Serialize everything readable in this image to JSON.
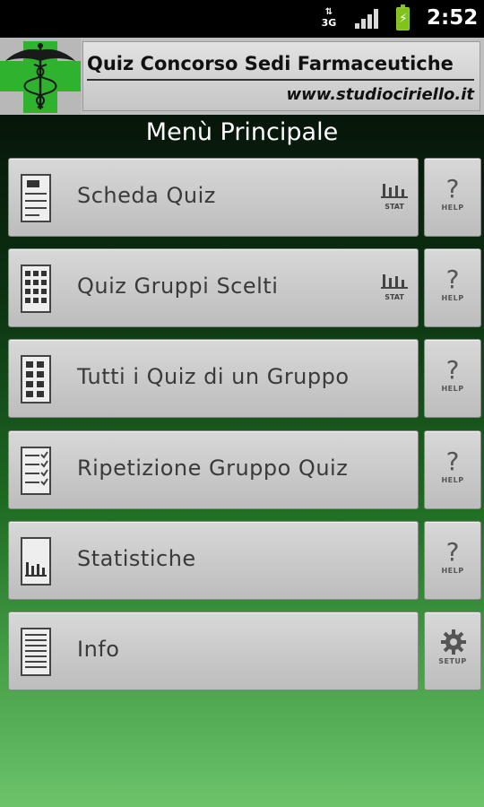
{
  "status_bar": {
    "network": "3G",
    "time": "2:52"
  },
  "header": {
    "title": "Quiz Concorso Sedi Farmaceutiche",
    "website": "www.studiociriello.it"
  },
  "menu_title": "Menù Principale",
  "menu": [
    {
      "label": "Scheda Quiz",
      "icon": "quiz-sheet-icon",
      "stat": "STAT",
      "help": "HELP"
    },
    {
      "label": "Quiz Gruppi Scelti",
      "icon": "grid-checklist-icon",
      "stat": "STAT",
      "help": "HELP"
    },
    {
      "label": "Tutti i Quiz di un Gruppo",
      "icon": "grid-list-icon",
      "help": "HELP"
    },
    {
      "label": "Ripetizione Gruppo Quiz",
      "icon": "checklist-icon",
      "help": "HELP"
    },
    {
      "label": "Statistiche",
      "icon": "bar-chart-icon",
      "help": "HELP"
    },
    {
      "label": "Info",
      "icon": "document-icon",
      "setup": "SETUP"
    }
  ],
  "colors": {
    "cross_green": "#2fb32f",
    "battery_green": "#7fc31c"
  }
}
